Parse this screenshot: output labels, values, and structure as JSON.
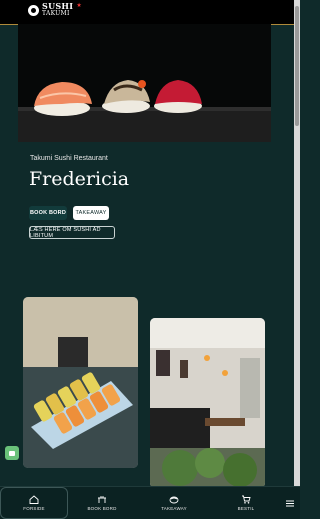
{
  "header": {
    "logo_line1": "SUSHI",
    "logo_line2": "TAKUMI",
    "logo_star": "★"
  },
  "restaurant": {
    "subtitle": "Takumi Sushi Restaurant",
    "title": "Fredericia"
  },
  "actions": {
    "book_label": "BOOK BORD",
    "takeaway_label": "TAKEAWAY",
    "read_more_label": "LÆS HERE OM SUSHI AD LIBITUM"
  },
  "bottom_nav": {
    "items": [
      {
        "label": "FORSIDE",
        "icon": "home-icon"
      },
      {
        "label": "BOOK BORD",
        "icon": "table-icon"
      },
      {
        "label": "TAKEAWAY",
        "icon": "sushi-icon"
      },
      {
        "label": "BESTIL",
        "icon": "cart-icon"
      },
      {
        "label": "",
        "icon": "menu-icon"
      }
    ]
  },
  "colors": {
    "background": "#0f2a2a",
    "accent": "#123b3b",
    "chat": "#6ac27a",
    "header_line": "#b08a3a"
  }
}
